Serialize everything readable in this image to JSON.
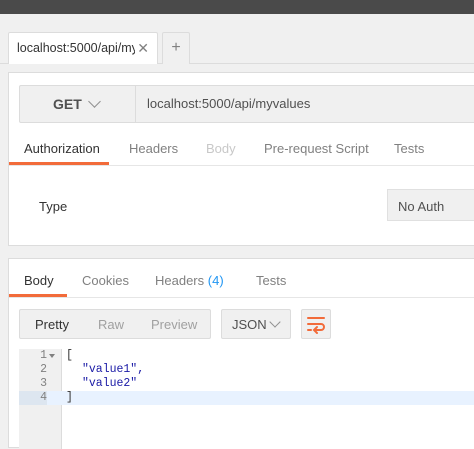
{
  "tab": {
    "title": "localhost:5000/api/my",
    "close_icon": "close-icon",
    "add_icon": "plus-icon"
  },
  "request": {
    "method": "GET",
    "url": "localhost:5000/api/myvalues"
  },
  "request_tabs": [
    "Authorization",
    "Headers",
    "Body",
    "Pre-request Script",
    "Tests"
  ],
  "auth": {
    "type_label": "Type",
    "type_value": "No Auth"
  },
  "response_tabs": {
    "body": "Body",
    "cookies": "Cookies",
    "headers": "Headers",
    "headers_count": "(4)",
    "tests": "Tests"
  },
  "view_modes": [
    "Pretty",
    "Raw",
    "Preview"
  ],
  "format": "JSON",
  "code": {
    "line_numbers": [
      "1",
      "2",
      "3",
      "4"
    ],
    "lines": [
      "[",
      "\"value1\",",
      "\"value2\"",
      "]"
    ]
  },
  "colors": {
    "accent": "#f26b3a",
    "count": "#2196f3",
    "wrap_icon": "#f26b3a"
  }
}
